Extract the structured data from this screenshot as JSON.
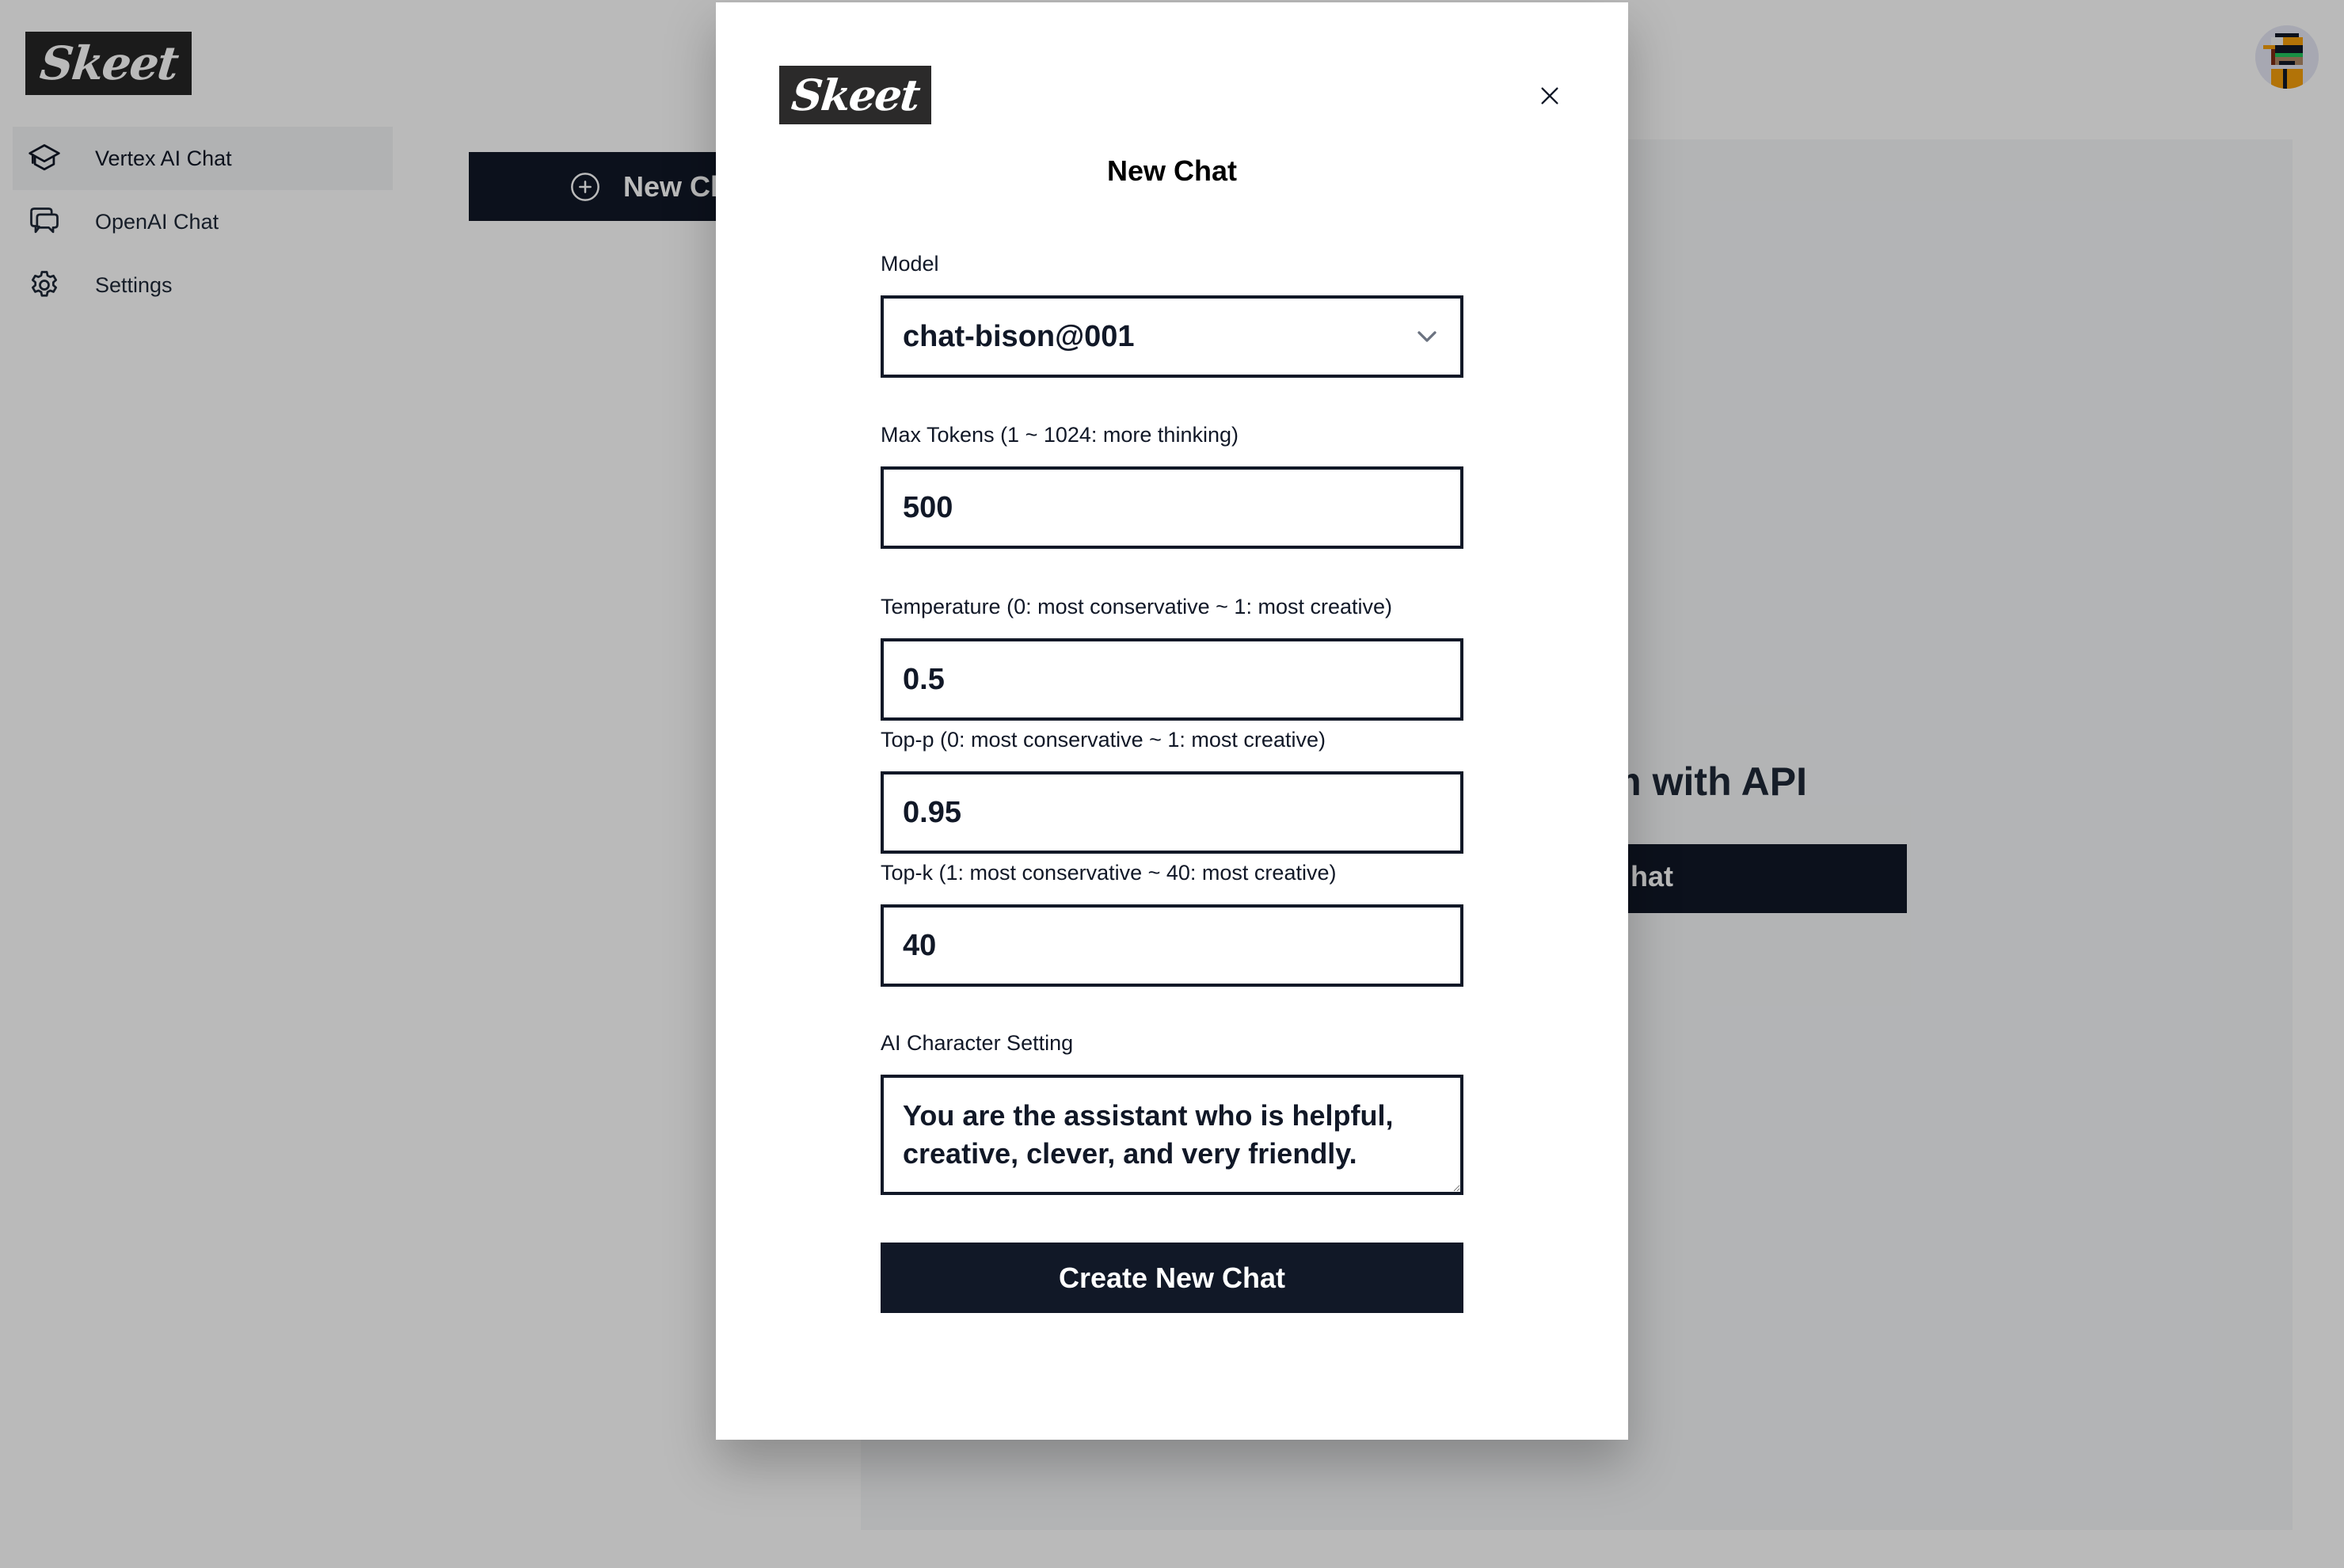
{
  "app": {
    "logo_text": "Skeet",
    "sidebar": {
      "items": [
        {
          "label": "Vertex AI Chat",
          "icon": "graduation-cap-icon",
          "active": true
        },
        {
          "label": "OpenAI Chat",
          "icon": "chat-bubbles-icon",
          "active": false
        },
        {
          "label": "Settings",
          "icon": "gear-icon",
          "active": false
        }
      ]
    },
    "new_chat_button_label_visible": "New Ch",
    "main": {
      "heading_visible": "m with API",
      "start_button_label_visible": "hat"
    },
    "avatar": {
      "icon": "pixel-avatar-icon"
    }
  },
  "modal": {
    "logo_text": "Skeet",
    "title": "New Chat",
    "close_icon": "close-icon",
    "fields": {
      "model": {
        "label": "Model",
        "value": "chat-bison@001"
      },
      "max_tokens": {
        "label": "Max Tokens (1 ~ 1024: more thinking)",
        "value": "500"
      },
      "temperature": {
        "label": "Temperature (0: most conservative ~ 1: most creative)",
        "value": "0.5"
      },
      "top_p": {
        "label": "Top-p (0: most conservative ~ 1: most creative)",
        "value": "0.95"
      },
      "top_k": {
        "label": "Top-k (1: most conservative ~ 40: most creative)",
        "value": "40"
      },
      "character": {
        "label": "AI Character Setting",
        "value": "You are the assistant who is helpful, creative, clever, and very friendly."
      }
    },
    "submit_label": "Create New Chat"
  },
  "colors": {
    "primary_dark": "#111827",
    "overlay": "rgba(0,0,0,0.27)",
    "panel": "#f6f7f9"
  }
}
